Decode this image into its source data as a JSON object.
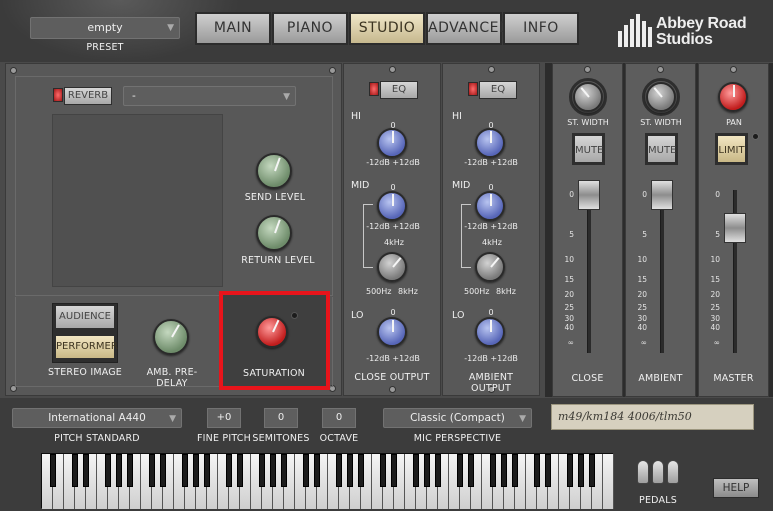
{
  "preset": {
    "value": "empty",
    "label": "PRESET"
  },
  "tabs": [
    {
      "label": "MAIN"
    },
    {
      "label": "PIANO"
    },
    {
      "label": "STUDIO",
      "active": true
    },
    {
      "label": "ADVANCED"
    },
    {
      "label": "INFO"
    }
  ],
  "logo": {
    "line1": "Abbey Road",
    "line2": "Studios"
  },
  "reverb": {
    "button_label": "REVERB",
    "preset_value": "-",
    "send_label": "SEND LEVEL",
    "return_label": "RETURN LEVEL"
  },
  "stereo": {
    "audience": "AUDIENCE",
    "performer": "PERFORMER",
    "label": "STEREO IMAGE",
    "predelay_label": "AMB. PRE-DELAY"
  },
  "saturation": {
    "label": "SATURATION",
    "highlight_color": "#e8141b"
  },
  "close_eq": {
    "eq_label": "EQ",
    "hi": "HI",
    "mid": "MID",
    "lo": "LO",
    "zero": "0",
    "range": "-12dB +12dB",
    "freq_top": "4kHz",
    "freq_low": "500Hz",
    "freq_high": "8kHz",
    "output_label": "CLOSE OUTPUT"
  },
  "ambient_eq": {
    "eq_label": "EQ",
    "hi": "HI",
    "mid": "MID",
    "lo": "LO",
    "zero": "0",
    "range": "-12dB +12dB",
    "freq_top": "4kHz",
    "freq_low": "500Hz",
    "freq_high": "8kHz",
    "output_label": "AMBIENT OUTPUT"
  },
  "mixer": {
    "close": {
      "knob_label": "ST. WIDTH",
      "button": "MUTE",
      "name": "CLOSE"
    },
    "ambient": {
      "knob_label": "ST. WIDTH",
      "button": "MUTE",
      "name": "AMBIENT"
    },
    "master": {
      "knob_label": "PAN",
      "button": "LIMIT",
      "name": "MASTER"
    },
    "scale": [
      "0",
      "5",
      "10",
      "15",
      "20",
      "25",
      "30",
      "40",
      "∞"
    ]
  },
  "bottom": {
    "pitch_standard_value": "International  A440",
    "pitch_standard_label": "PITCH STANDARD",
    "fine_pitch_value": "+0",
    "fine_pitch_label": "FINE PITCH",
    "semitones_value": "0",
    "semitones_label": "SEMITONES",
    "octave_value": "0",
    "octave_label": "OCTAVE",
    "mic_perspective_value": "Classic (Compact)",
    "mic_perspective_label": "MIC PERSPECTIVE",
    "mic_note": "m49/km184 4006/tlm50",
    "pedals_label": "PEDALS",
    "help_label": "HELP"
  }
}
